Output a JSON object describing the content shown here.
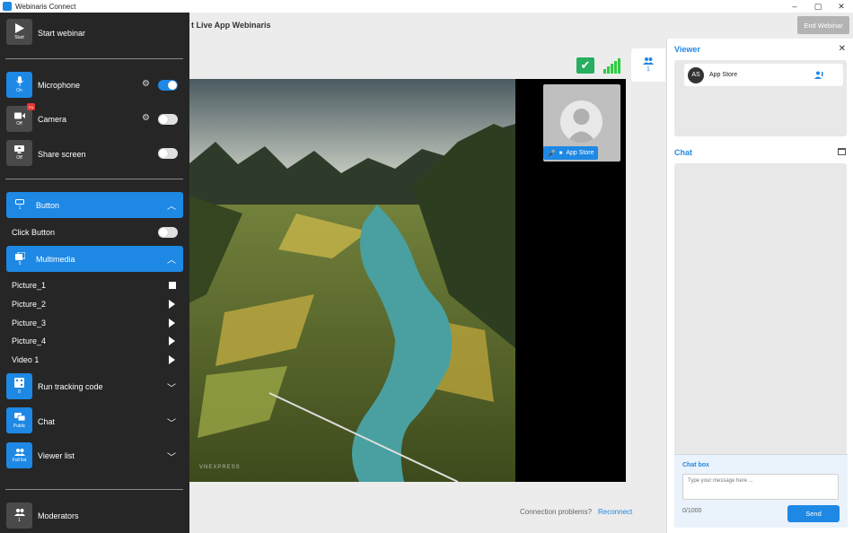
{
  "window": {
    "title": "Webinaris Connect",
    "controls": [
      "–",
      "▢",
      "✕"
    ]
  },
  "header": {
    "page_title": "t Live App Webinaris",
    "end_button": "End Webinar"
  },
  "viewer_tab": {
    "count": "1"
  },
  "sidebar": {
    "start": {
      "label": "Start webinar",
      "sub": "Start"
    },
    "microphone": {
      "label": "Microphone",
      "sub": "On",
      "toggle": "on"
    },
    "camera": {
      "label": "Camera",
      "sub": "Off",
      "badge": "Pa",
      "toggle": "off"
    },
    "share": {
      "label": "Share screen",
      "sub": "Off",
      "toggle": "off"
    },
    "button_section": {
      "label": "Button",
      "count": "1"
    },
    "click_button": {
      "label": "Click Button"
    },
    "multimedia_section": {
      "label": "Multimedia",
      "count": "5"
    },
    "media_items": [
      {
        "label": "Picture_1",
        "state": "stop"
      },
      {
        "label": "Picture_2",
        "state": "play"
      },
      {
        "label": "Picture_3",
        "state": "play"
      },
      {
        "label": "Picture_4",
        "state": "play"
      },
      {
        "label": "Video 1",
        "state": "play"
      }
    ],
    "tracking": {
      "label": "Run tracking code",
      "sub": "0"
    },
    "chat": {
      "label": "Chat",
      "sub": "Public"
    },
    "viewer_list": {
      "label": "Viewer list",
      "sub": "Full list"
    },
    "moderators": {
      "label": "Moderators",
      "sub": "1"
    }
  },
  "video": {
    "participant_name": "App Store",
    "watermark": "VNEXPRESS"
  },
  "connection": {
    "text": "Connection problems?",
    "link": "Reconnect"
  },
  "viewer_panel": {
    "title": "Viewer",
    "viewers": [
      {
        "initials": "AS",
        "name": "App Store"
      }
    ]
  },
  "chat_panel": {
    "title": "Chat",
    "box_title": "Chat box",
    "placeholder": "Type your message here ...",
    "counter": "0/1000",
    "send_label": "Send"
  },
  "colors": {
    "accent": "#1e88e5",
    "sidebar_bg": "#262626",
    "status_green": "#27ae60"
  }
}
